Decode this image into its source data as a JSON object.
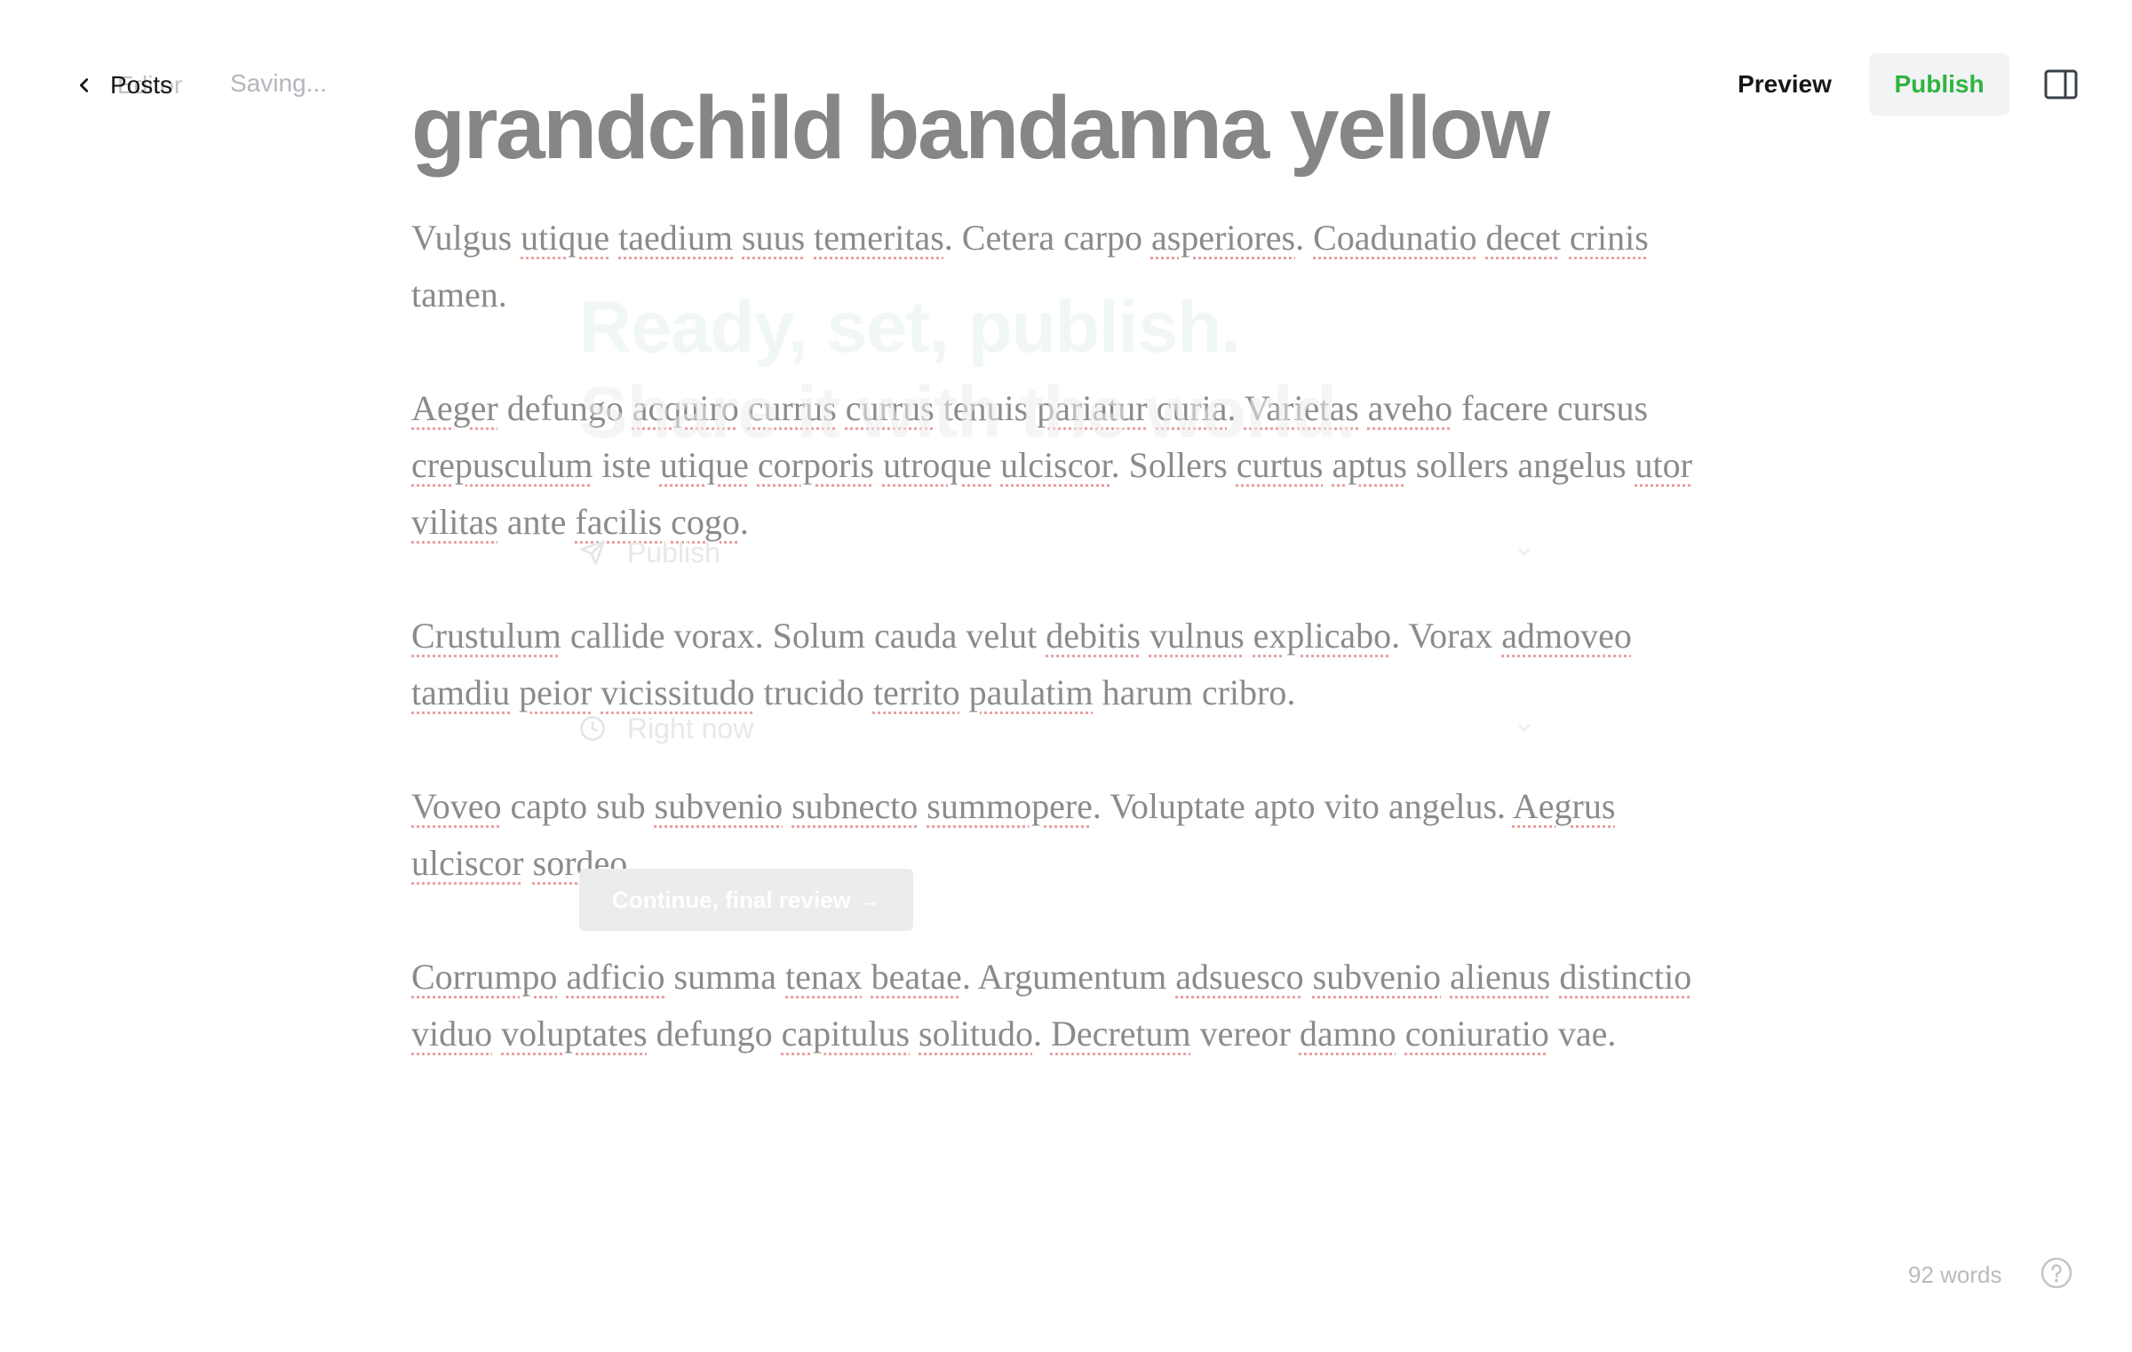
{
  "header": {
    "back_label": "Posts",
    "back_ghost_label": "Editor",
    "status": "Saving...",
    "preview_label": "Preview",
    "publish_label": "Publish"
  },
  "post": {
    "title": "grandchild bandanna yellow",
    "paragraphs": [
      [
        {
          "t": "Vulgus "
        },
        {
          "t": "utique",
          "sp": true
        },
        {
          "t": " "
        },
        {
          "t": "taedium",
          "sp": true
        },
        {
          "t": " "
        },
        {
          "t": "suus",
          "sp": true
        },
        {
          "t": " "
        },
        {
          "t": "temeritas",
          "sp": true
        },
        {
          "t": ". Cetera carpo "
        },
        {
          "t": "asperiores",
          "sp": true
        },
        {
          "t": ". "
        },
        {
          "t": "Coadunatio",
          "sp": true
        },
        {
          "t": " "
        },
        {
          "t": "decet",
          "sp": true
        },
        {
          "t": " "
        },
        {
          "t": "crinis",
          "sp": true
        },
        {
          "t": " tamen."
        }
      ],
      [
        {
          "t": "Aeger",
          "sp": true
        },
        {
          "t": " defungo "
        },
        {
          "t": "acquiro",
          "sp": true
        },
        {
          "t": " "
        },
        {
          "t": "currus",
          "sp": true
        },
        {
          "t": " "
        },
        {
          "t": "currus",
          "sp": true
        },
        {
          "t": " tenuis "
        },
        {
          "t": "pariatur",
          "sp": true
        },
        {
          "t": " "
        },
        {
          "t": "curia",
          "sp": true
        },
        {
          "t": ". "
        },
        {
          "t": "Varietas",
          "sp": true
        },
        {
          "t": " "
        },
        {
          "t": "aveho",
          "sp": true
        },
        {
          "t": " facere cursus "
        },
        {
          "t": "crepusculum",
          "sp": true
        },
        {
          "t": " iste "
        },
        {
          "t": "utique",
          "sp": true
        },
        {
          "t": " "
        },
        {
          "t": "corporis",
          "sp": true
        },
        {
          "t": " "
        },
        {
          "t": "utroque",
          "sp": true
        },
        {
          "t": " "
        },
        {
          "t": "ulciscor",
          "sp": true
        },
        {
          "t": ". Sollers "
        },
        {
          "t": "curtus",
          "sp": true
        },
        {
          "t": " "
        },
        {
          "t": "aptus",
          "sp": true
        },
        {
          "t": " sollers angelus "
        },
        {
          "t": "utor",
          "sp": true
        },
        {
          "t": " "
        },
        {
          "t": "vilitas",
          "sp": true
        },
        {
          "t": " ante "
        },
        {
          "t": "facilis",
          "sp": true
        },
        {
          "t": " "
        },
        {
          "t": "cogo",
          "sp": true
        },
        {
          "t": "."
        }
      ],
      [
        {
          "t": "Crustulum",
          "sp": true
        },
        {
          "t": " callide vorax. Solum cauda velut "
        },
        {
          "t": "debitis",
          "sp": true
        },
        {
          "t": " "
        },
        {
          "t": "vulnus",
          "sp": true
        },
        {
          "t": " "
        },
        {
          "t": "explicabo",
          "sp": true
        },
        {
          "t": ". Vorax "
        },
        {
          "t": "admoveo",
          "sp": true
        },
        {
          "t": " "
        },
        {
          "t": "tamdiu",
          "sp": true
        },
        {
          "t": " "
        },
        {
          "t": "peior",
          "sp": true
        },
        {
          "t": " "
        },
        {
          "t": "vicissitudo",
          "sp": true
        },
        {
          "t": " trucido "
        },
        {
          "t": "territo",
          "sp": true
        },
        {
          "t": " "
        },
        {
          "t": "paulatim",
          "sp": true
        },
        {
          "t": " harum cribro."
        }
      ],
      [
        {
          "t": "Voveo",
          "sp": true
        },
        {
          "t": " capto sub "
        },
        {
          "t": "subvenio",
          "sp": true
        },
        {
          "t": " "
        },
        {
          "t": "subnecto",
          "sp": true
        },
        {
          "t": " "
        },
        {
          "t": "summopere",
          "sp": true
        },
        {
          "t": ". Voluptate apto vito angelus. "
        },
        {
          "t": "Aegrus",
          "sp": true
        },
        {
          "t": " "
        },
        {
          "t": "ulciscor",
          "sp": true
        },
        {
          "t": " "
        },
        {
          "t": "sordeo",
          "sp": true
        },
        {
          "t": "."
        }
      ],
      [
        {
          "t": "Corrumpo",
          "sp": true
        },
        {
          "t": " "
        },
        {
          "t": "adficio",
          "sp": true
        },
        {
          "t": " summa "
        },
        {
          "t": "tenax",
          "sp": true
        },
        {
          "t": " "
        },
        {
          "t": "beatae",
          "sp": true
        },
        {
          "t": ". Argumentum "
        },
        {
          "t": "adsuesco",
          "sp": true
        },
        {
          "t": " "
        },
        {
          "t": "subvenio",
          "sp": true
        },
        {
          "t": " "
        },
        {
          "t": "alienus",
          "sp": true
        },
        {
          "t": " "
        },
        {
          "t": "distinctio",
          "sp": true
        },
        {
          "t": " "
        },
        {
          "t": "viduo",
          "sp": true
        },
        {
          "t": " "
        },
        {
          "t": "voluptates",
          "sp": true
        },
        {
          "t": " defungo "
        },
        {
          "t": "capitulus",
          "sp": true
        },
        {
          "t": " "
        },
        {
          "t": "solitudo",
          "sp": true
        },
        {
          "t": ". "
        },
        {
          "t": "Decretum",
          "sp": true
        },
        {
          "t": " vereor "
        },
        {
          "t": "damno",
          "sp": true
        },
        {
          "t": " "
        },
        {
          "t": "coniuratio",
          "sp": true
        },
        {
          "t": " vae."
        }
      ]
    ]
  },
  "publish_overlay": {
    "title_line1": "Ready, set, publish.",
    "title_line2": "Share it with the world.",
    "publish_option": "Publish",
    "schedule_option": "Right now",
    "continue_label": "Continue, final review →"
  },
  "footer": {
    "word_count": "92 words"
  },
  "colors": {
    "accent_green": "#30b43f",
    "spellcheck_underline": "#e8a1a1"
  },
  "icons": {
    "back": "chevron-left-icon",
    "sidebar": "sidebar-panel-icon",
    "help": "question-circle-icon",
    "publish": "send-icon",
    "schedule": "clock-icon"
  }
}
